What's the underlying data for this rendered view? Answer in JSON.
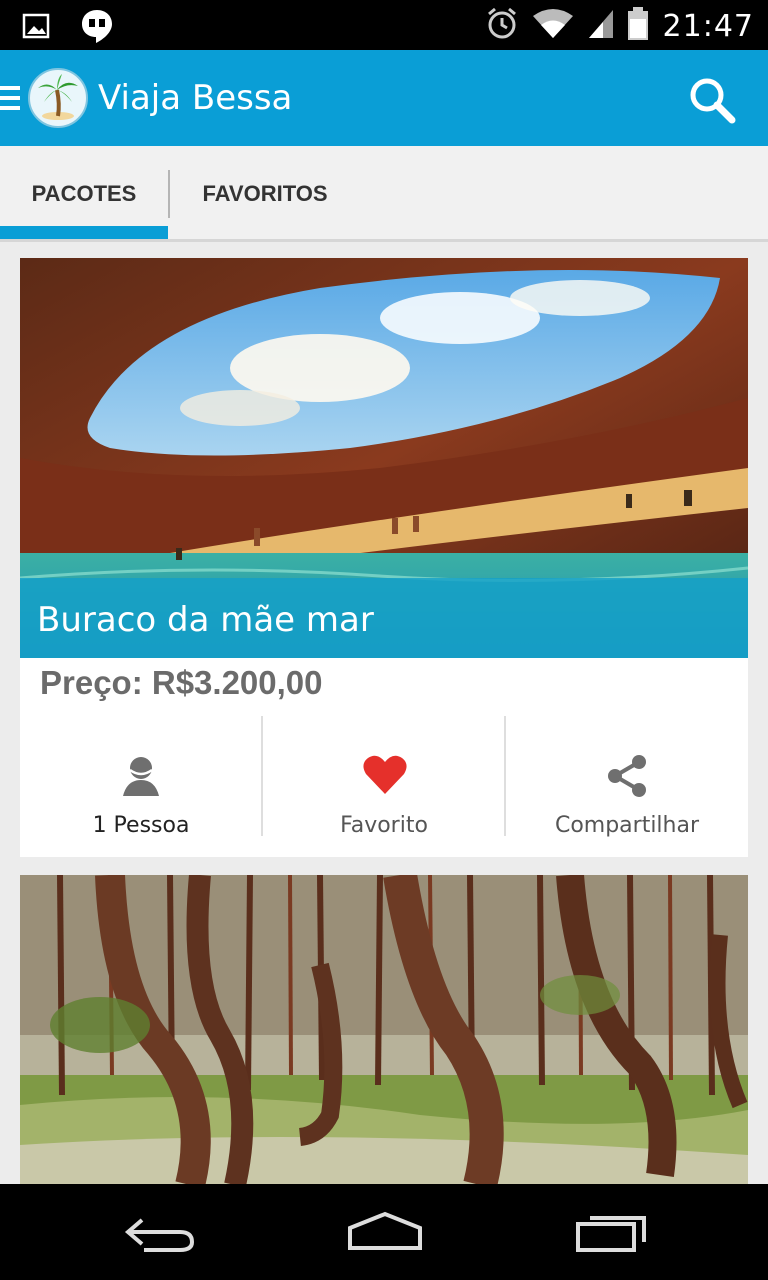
{
  "status_bar": {
    "time": "21:47",
    "left_icons": [
      "image-icon",
      "hangouts-icon"
    ],
    "right_icons": [
      "alarm-icon",
      "wifi-icon",
      "signal-icon",
      "battery-icon"
    ]
  },
  "action_bar": {
    "app_title": "Viaja Bessa",
    "background_color": "#0a9ed6"
  },
  "tabs": [
    {
      "label": "PACOTES",
      "selected": true
    },
    {
      "label": "FAVORITOS",
      "selected": false
    }
  ],
  "cards": [
    {
      "title": "Buraco da mãe mar",
      "price": "Preço: R$3.200,00",
      "actions": [
        {
          "icon": "person-icon",
          "label": "1 Pessoa"
        },
        {
          "icon": "heart-icon",
          "label": "Favorito"
        },
        {
          "icon": "share-icon",
          "label": "Compartilhar"
        }
      ]
    },
    {
      "image": "crooked-forest-image"
    }
  ],
  "nav_bar": {
    "buttons": [
      "back-icon",
      "home-icon",
      "recent-apps-icon"
    ]
  }
}
